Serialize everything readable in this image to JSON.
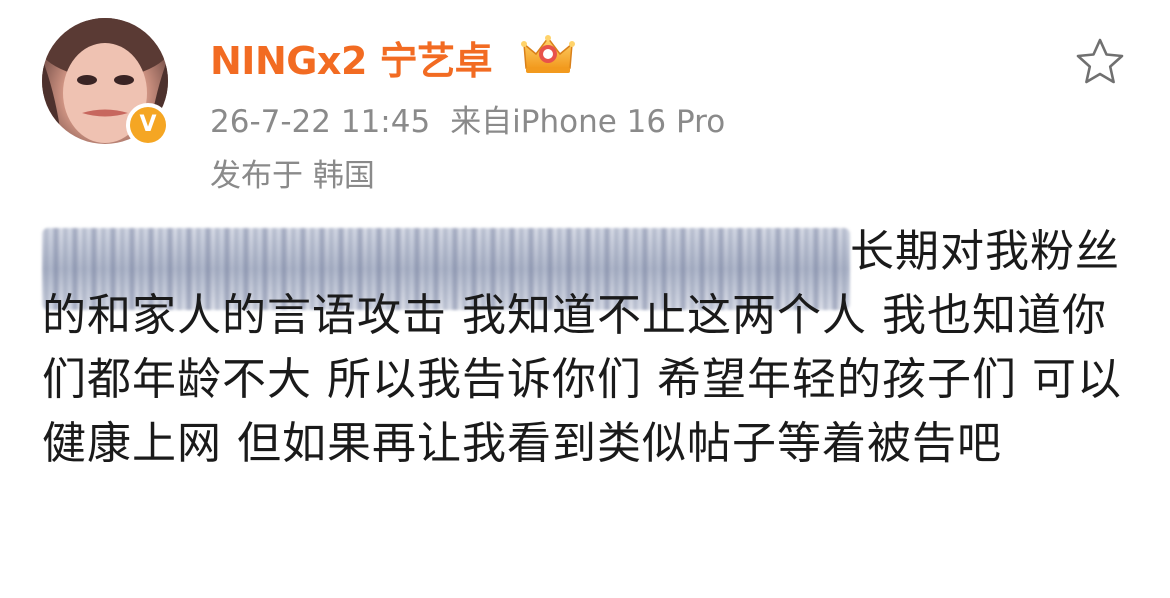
{
  "post": {
    "author": {
      "name": "NINGx2 宁艺卓",
      "verified": true,
      "verified_badge_text": "V",
      "crown_icon": "crown-icon",
      "avatar_icon": "avatar"
    },
    "meta": {
      "datetime": "26-7-22 11:45",
      "source": "来自iPhone 16 Pro",
      "location": "发布于 韩国"
    },
    "actions": {
      "favorite_icon": "star-icon"
    },
    "body": {
      "redacted": true,
      "text": "长期对我粉丝的和家人的言语攻击 我知道不止这两个人 我也知道你们都年龄不大 所以我告诉你们 希望年轻的孩子们 可以健康上网 但如果再让我看到类似帖子等着被告吧"
    }
  },
  "colors": {
    "username": "#f26b22",
    "meta_text": "#8a8a8a",
    "body_text": "#1a1a1a",
    "verified_badge": "#f5a623"
  }
}
